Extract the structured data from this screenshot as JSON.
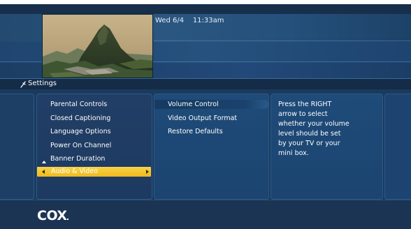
{
  "header": {
    "date": "Wed 6/4",
    "time": "11:33am"
  },
  "breadcrumb": {
    "icon": "settings-wrench-icon",
    "label": "Settings"
  },
  "menu": {
    "items": [
      {
        "label": "Parental Controls"
      },
      {
        "label": "Closed Captioning"
      },
      {
        "label": "Language Options"
      },
      {
        "label": "Power On Channel"
      },
      {
        "label": "Banner Duration"
      }
    ],
    "selected": {
      "label": "Audio & Video"
    }
  },
  "submenu": {
    "items": [
      {
        "label": "Volume Control"
      },
      {
        "label": "Video Output Format"
      },
      {
        "label": "Restore Defaults"
      }
    ]
  },
  "help": {
    "lines": [
      "Press the RIGHT",
      "arrow to select",
      "whether your volume",
      "level should be set",
      "by your TV or your",
      "mini box."
    ]
  },
  "footer": {
    "logo": "COX"
  },
  "colors": {
    "highlight": "#f3c02a",
    "background": "#1b3a5c"
  }
}
